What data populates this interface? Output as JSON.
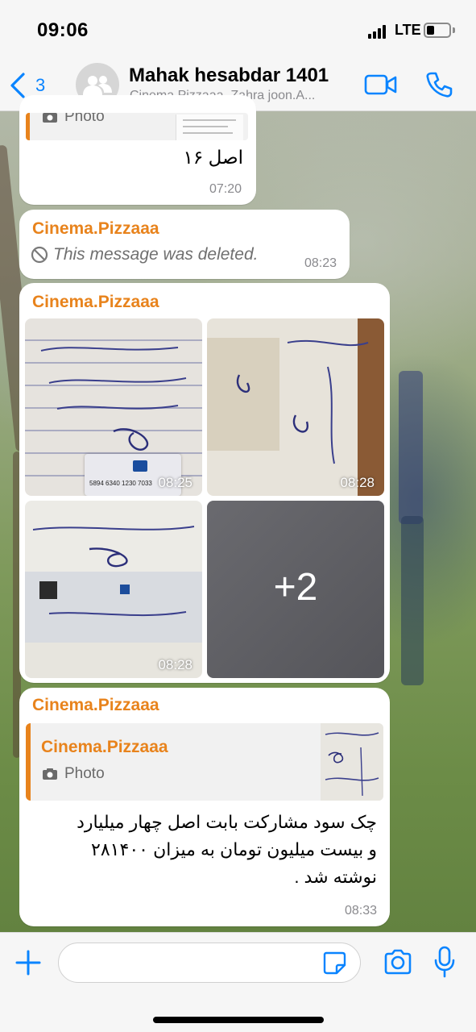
{
  "status_bar": {
    "time": "09:06",
    "network": "LTE"
  },
  "header": {
    "back_count": "3",
    "title": "Mahak hesabdar 1401",
    "subtitle": "Cinema.Pizzaaa, Zahra joon.A..."
  },
  "messages": [
    {
      "type": "photo_reply",
      "reply_label": "Photo",
      "text": "اصل ۱۶",
      "time": "07:20"
    },
    {
      "type": "deleted",
      "sender": "Cinema.Pizzaaa",
      "text": "This message was deleted.",
      "time": "08:23"
    },
    {
      "type": "album",
      "sender": "Cinema.Pizzaaa",
      "photos": [
        {
          "time": "08:25",
          "card_number": "5894 6340 1230 7033"
        },
        {
          "time": "08:28"
        },
        {
          "time": "08:28"
        },
        {
          "more": "+2"
        }
      ]
    },
    {
      "type": "reply",
      "sender": "Cinema.Pizzaaa",
      "quoted_sender": "Cinema.Pizzaaa",
      "quoted_label": "Photo",
      "text_lines": [
        "چک سود مشارکت بابت اصل چهار میلیارد",
        "و بیست میلیون تومان به میزان ۲۸۱۴۰۰",
        "نوشته شد ."
      ],
      "time": "08:33"
    }
  ],
  "input": {
    "value": "",
    "placeholder": ""
  },
  "icons": {
    "back": "chevron-left-icon",
    "avatar": "group-avatar-icon",
    "video": "video-call-icon",
    "call": "phone-icon",
    "plus": "plus-icon",
    "sticker": "sticker-icon",
    "camera": "camera-icon",
    "mic": "microphone-icon",
    "photo": "camera-small-icon",
    "deleted": "blocked-icon"
  },
  "colors": {
    "accent": "#0a84ff",
    "sender": "#e8831c",
    "reply_bar": "#e8831c"
  }
}
